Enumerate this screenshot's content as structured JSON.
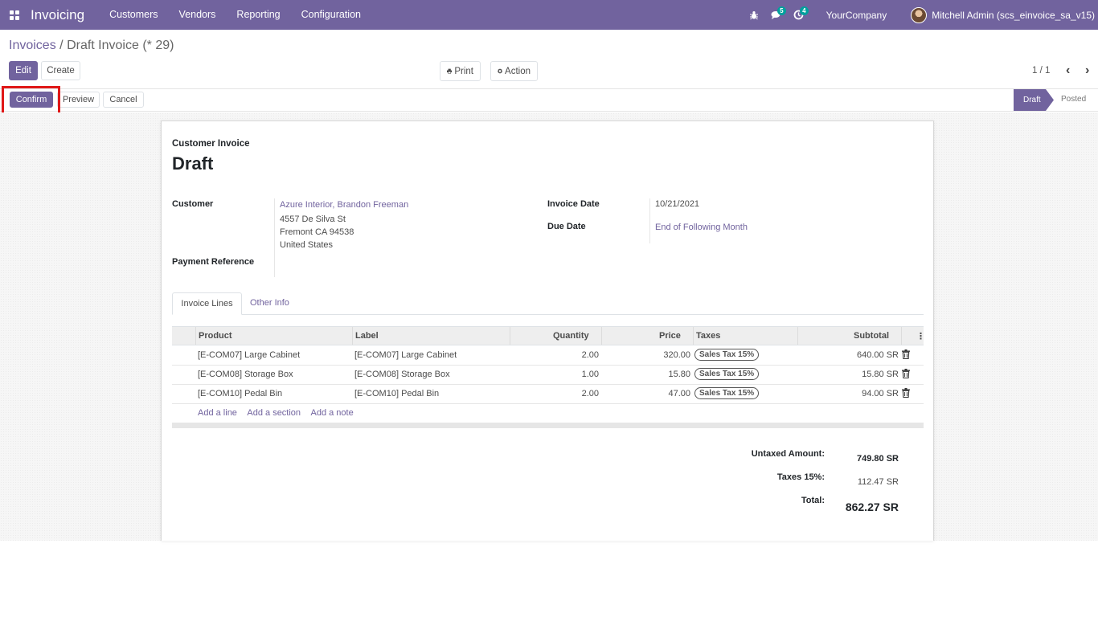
{
  "navbar": {
    "app_name": "Invoicing",
    "menu": [
      "Customers",
      "Vendors",
      "Reporting",
      "Configuration"
    ],
    "messages_badge": "5",
    "activities_badge": "4",
    "company": "YourCompany",
    "user": "Mitchell Admin (scs_einvoice_sa_v15)"
  },
  "breadcrumb": {
    "parent": "Invoices",
    "separator": "/",
    "current": "Draft Invoice (* 29)"
  },
  "toolbar": {
    "edit": "Edit",
    "create": "Create",
    "print": "Print",
    "action": "Action",
    "pager": "1 / 1"
  },
  "statusbar": {
    "confirm": "Confirm",
    "preview": "Preview",
    "cancel": "Cancel",
    "stages": [
      "Draft",
      "Posted"
    ],
    "active_stage": "Draft"
  },
  "invoice": {
    "type": "Customer Invoice",
    "title": "Draft",
    "customer_label": "Customer",
    "customer_name": "Azure Interior, Brandon Freeman",
    "address": [
      "4557 De Silva St",
      "Fremont CA 94538",
      "United States"
    ],
    "payment_reference_label": "Payment Reference",
    "invoice_date_label": "Invoice Date",
    "invoice_date": "10/21/2021",
    "due_date_label": "Due Date",
    "due_date": "End of Following Month"
  },
  "tabs": [
    "Invoice Lines",
    "Other Info"
  ],
  "table": {
    "headers": [
      "Product",
      "Label",
      "Quantity",
      "Price",
      "Taxes",
      "Subtotal"
    ],
    "rows": [
      {
        "product": "[E-COM07] Large Cabinet",
        "label": "[E-COM07] Large Cabinet",
        "quantity": "2.00",
        "price": "320.00",
        "tax": "Sales Tax 15%",
        "subtotal": "640.00 SR"
      },
      {
        "product": "[E-COM08] Storage Box",
        "label": "[E-COM08] Storage Box",
        "quantity": "1.00",
        "price": "15.80",
        "tax": "Sales Tax 15%",
        "subtotal": "15.80 SR"
      },
      {
        "product": "[E-COM10] Pedal Bin",
        "label": "[E-COM10] Pedal Bin",
        "quantity": "2.00",
        "price": "47.00",
        "tax": "Sales Tax 15%",
        "subtotal": "94.00 SR"
      }
    ],
    "add_links": [
      "Add a line",
      "Add a section",
      "Add a note"
    ]
  },
  "totals": {
    "untaxed_label": "Untaxed Amount:",
    "untaxed_value": "749.80 SR",
    "taxes_label": "Taxes 15%:",
    "taxes_value": "112.47 SR",
    "total_label": "Total:",
    "total_value": "862.27 SR"
  },
  "colors": {
    "brand": "#71639e",
    "badge": "#00a09d",
    "highlight": "#e01818"
  }
}
